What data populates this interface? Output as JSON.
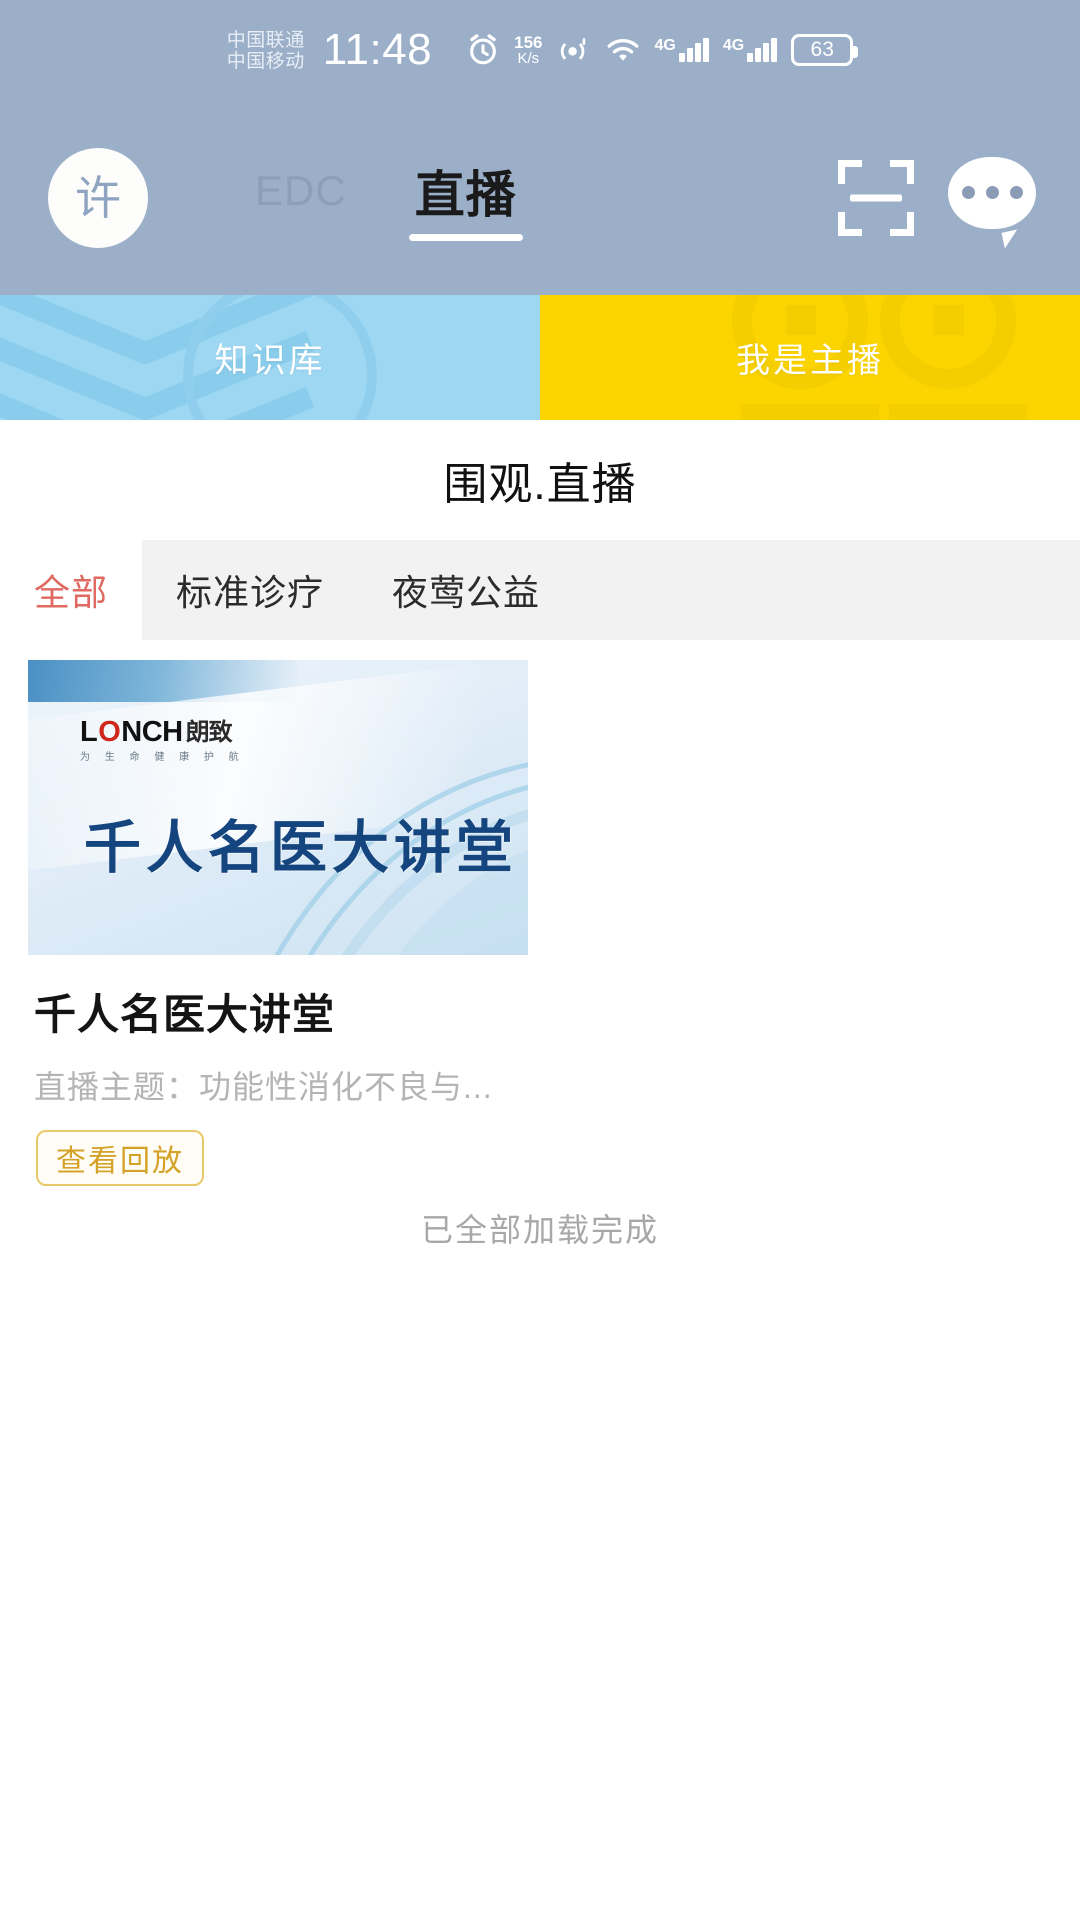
{
  "statusbar": {
    "carrier_primary": "中国联通",
    "carrier_secondary": "中国移动",
    "time": "11:48",
    "alarm_icon": "alarm-icon",
    "netspeed_value": "156",
    "netspeed_unit": "K/s",
    "hotspot_icon": "hotspot-icon",
    "wifi_icon": "wifi-icon",
    "sim1_label": "4G",
    "sim2_label": "4G",
    "battery_percent": "63"
  },
  "header": {
    "avatar_initial": "许",
    "tabs": [
      {
        "label": "EDC",
        "active": false
      },
      {
        "label": "直播",
        "active": true
      }
    ],
    "scan_icon": "scan-icon",
    "message_icon": "message-bubble-icon"
  },
  "banner": {
    "left": {
      "label": "知识库",
      "color": "#9ed7f2"
    },
    "right": {
      "label": "我是主播",
      "color": "#fcd400"
    }
  },
  "page": {
    "title": "围观.直播"
  },
  "filters": {
    "items": [
      {
        "label": "全部",
        "active": true
      },
      {
        "label": "标准诊疗",
        "active": false
      },
      {
        "label": "夜莺公益",
        "active": false
      }
    ],
    "active_color": "#e06a62"
  },
  "card": {
    "thumbnail": {
      "logo_main": "L",
      "logo_o": "O",
      "logo_rest": "NCH",
      "logo_cn": "朗致",
      "logo_tagline": "为 生 命 健 康 护 航",
      "headline": "千人名医大讲堂"
    },
    "title": "千人名医大讲堂",
    "subtitle": "直播主题：功能性消化不良与...",
    "button_label": "查看回放",
    "button_color": "#d3a227"
  },
  "footer": {
    "loaded_all": "已全部加载完成"
  }
}
